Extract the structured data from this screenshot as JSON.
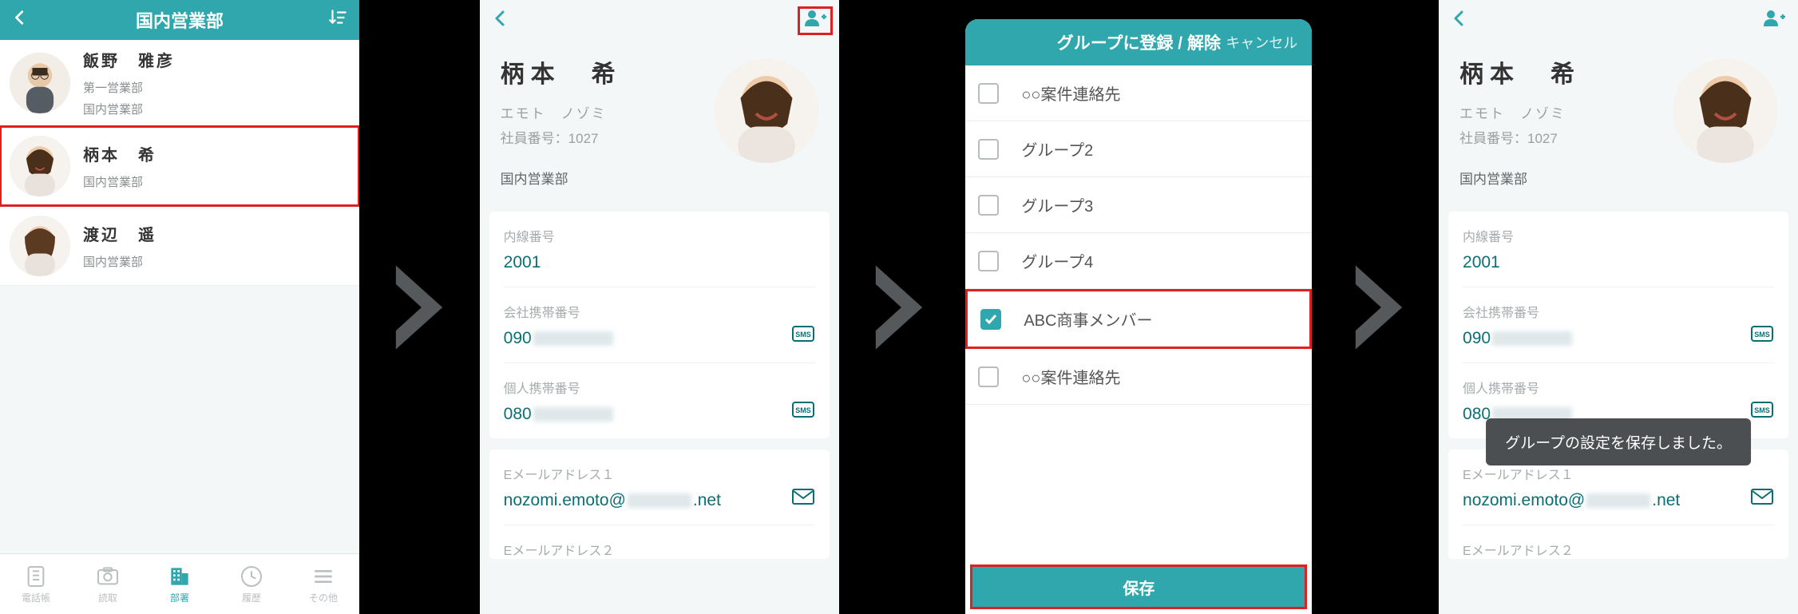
{
  "colors": {
    "teal": "#2fa7ac",
    "red": "#e02020"
  },
  "screen1": {
    "title": "国内営業部",
    "contacts": [
      {
        "name": "飯野　雅彦",
        "sub1": "第一営業部",
        "sub2": "国内営業部"
      },
      {
        "name": "柄本　希",
        "sub1": "国内営業部",
        "sub2": ""
      },
      {
        "name": "渡辺　遥",
        "sub1": "国内営業部",
        "sub2": ""
      }
    ],
    "tabs": [
      "電話帳",
      "読取",
      "部署",
      "履歴",
      "その他"
    ],
    "active_tab_index": 2
  },
  "screen2": {
    "name": "柄本　希",
    "kana": "エモト　ノゾミ",
    "emp_label": "社員番号：1027",
    "dept": "国内営業部",
    "ext_label": "内線番号",
    "ext_value": "2001",
    "company_mobile_label": "会社携帯番号",
    "company_mobile_value_prefix": "090",
    "personal_mobile_label": "個人携帯番号",
    "personal_mobile_value_prefix": "080",
    "email1_label": "Eメールアドレス１",
    "email1_prefix": "nozomi.emoto@",
    "email1_suffix": ".net",
    "email2_label": "Eメールアドレス２"
  },
  "screen3": {
    "title": "グループに登録 / 解除",
    "cancel": "キャンセル",
    "save": "保存",
    "groups": [
      {
        "label": "○○案件連絡先",
        "checked": false
      },
      {
        "label": "グループ2",
        "checked": false
      },
      {
        "label": "グループ3",
        "checked": false
      },
      {
        "label": "グループ4",
        "checked": false
      },
      {
        "label": "ABC商事メンバー",
        "checked": true
      },
      {
        "label": "○○案件連絡先",
        "checked": false
      }
    ]
  },
  "screen4": {
    "toast": "グループの設定を保存しました。"
  }
}
